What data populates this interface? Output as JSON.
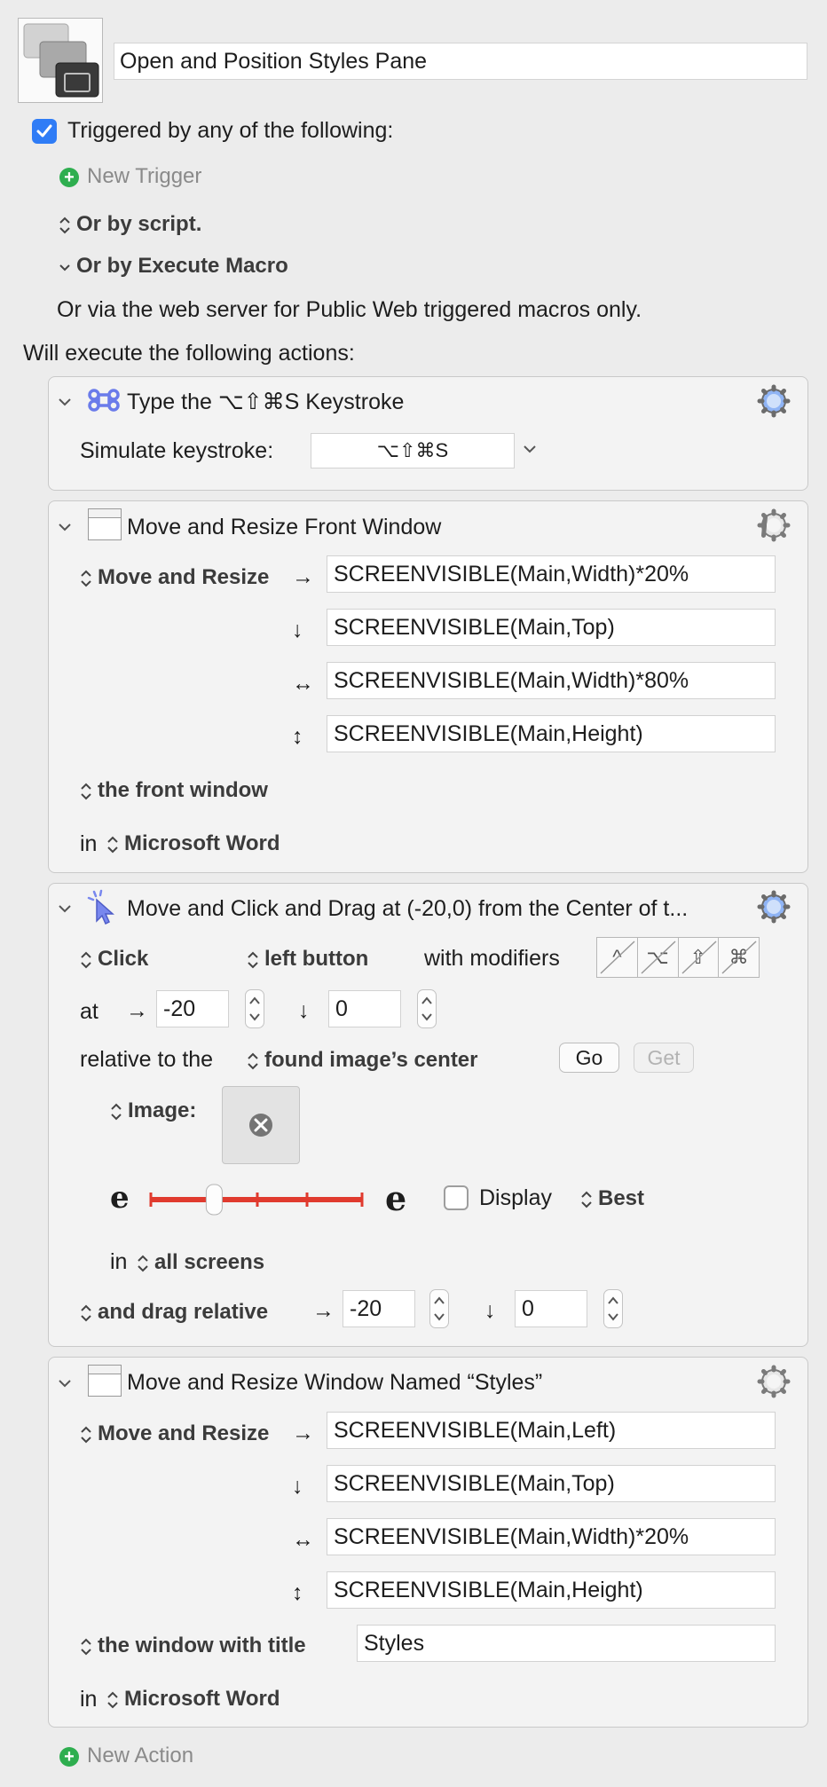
{
  "macro": {
    "title": "Open and Position Styles Pane",
    "triggered_label": "Triggered by any of the following:",
    "new_trigger": "New Trigger",
    "or_by_script": "Or by script.",
    "or_by_execute_macro": "Or by Execute Macro",
    "web_server_note": "Or via the web server for Public Web triggered macros only.",
    "will_execute": "Will execute the following actions:",
    "new_action": "New Action"
  },
  "actions": {
    "keystroke": {
      "title": "Type the ⌥⇧⌘S Keystroke",
      "simulate_label": "Simulate keystroke:",
      "keystroke_value": "⌥⇧⌘S"
    },
    "front_window": {
      "title": "Move and Resize Front Window",
      "mode": "Move and Resize",
      "left": "SCREENVISIBLE(Main,Width)*20%",
      "top": "SCREENVISIBLE(Main,Top)",
      "width": "SCREENVISIBLE(Main,Width)*80%",
      "height": "SCREENVISIBLE(Main,Height)",
      "target": "the front window",
      "in_label": "in",
      "app": "Microsoft Word"
    },
    "click_drag": {
      "title": "Move and Click and Drag at (-20,0) from the Center of t...",
      "click": "Click",
      "button": "left button",
      "with_modifiers": "with modifiers",
      "modifiers": [
        "^",
        "⌥",
        "⇧",
        "⌘"
      ],
      "at_label": "at",
      "x": "-20",
      "y": "0",
      "relative_label": "relative to the",
      "relative_target": "found image’s center",
      "go": "Go",
      "get": "Get",
      "image_label": "Image:",
      "fuzz_low_glyph": "e",
      "fuzz_high_glyph": "e",
      "fuzz_level": 0.3,
      "display_label": "Display",
      "best_label": "Best",
      "in_label": "in",
      "screens": "all screens",
      "drag_label": "and drag relative",
      "drag_x": "-20",
      "drag_y": "0"
    },
    "styles_window": {
      "title": "Move and Resize Window Named “Styles”",
      "mode": "Move and Resize",
      "left": "SCREENVISIBLE(Main,Left)",
      "top": "SCREENVISIBLE(Main,Top)",
      "width": "SCREENVISIBLE(Main,Width)*20%",
      "height": "SCREENVISIBLE(Main,Height)",
      "target": "the window with title",
      "window_title": "Styles",
      "in_label": "in",
      "app": "Microsoft Word"
    }
  },
  "arrows": {
    "right": "→",
    "down": "↓",
    "horizontal": "↔",
    "vertical": "↕"
  },
  "colors": {
    "accent_blue": "#2f7cf6",
    "green_plus": "#2eae4f",
    "slider_red": "#e03a2e",
    "gear_active": "#8fb4f5",
    "gear_inactive": "#8e8e8e"
  }
}
